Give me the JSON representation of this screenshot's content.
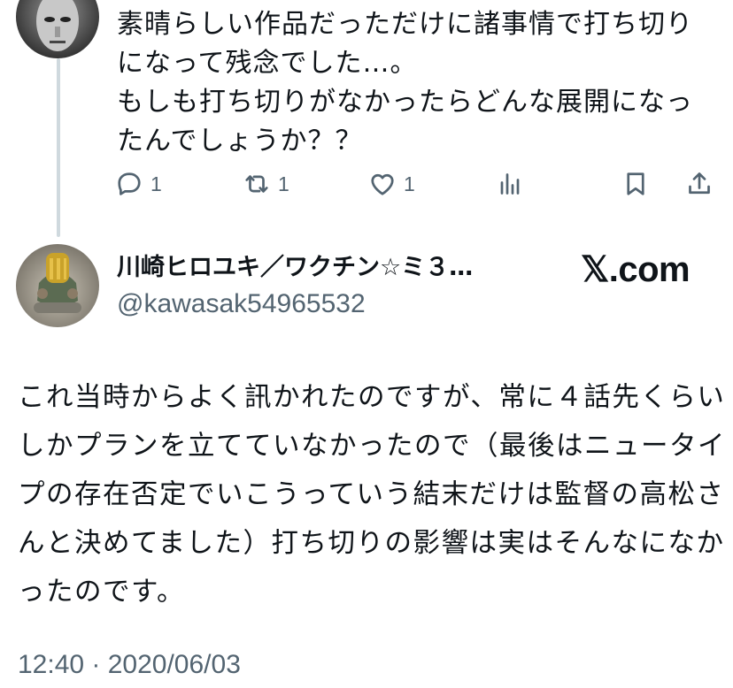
{
  "reply_tweet": {
    "text": "素晴らしい作品だっただけに諸事情で打ち切りになって残念でした…。\nもしも打ち切りがなかったらどんな展開になったんでしょうか？？",
    "actions": {
      "reply_count": "1",
      "retweet_count": "1",
      "like_count": "1"
    }
  },
  "main_tweet": {
    "author_name": "川崎ヒロユキ／ワクチン☆ミ３…",
    "author_handle": "@kawasak54965532",
    "brand": "𝕏.com",
    "text": "これ当時からよく訊かれたのですが、常に４話先くらいしかプランを立てていなかったので（最後はニュータイプの存在否定でいこうっていう結末だけは監督の高松さんと決めてました）打ち切りの影響は実はそんなになかったのです。",
    "timestamp": "12:40 · 2020/06/03"
  },
  "icons": {
    "reply": "speech-bubble-icon",
    "retweet": "retweet-arrows-icon",
    "like": "heart-icon",
    "views": "bar-chart-icon",
    "bookmark": "bookmark-icon",
    "share": "share-upload-icon"
  },
  "colors": {
    "text_primary": "#0f1419",
    "text_secondary": "#536471",
    "thread_line": "#cfd9de"
  }
}
